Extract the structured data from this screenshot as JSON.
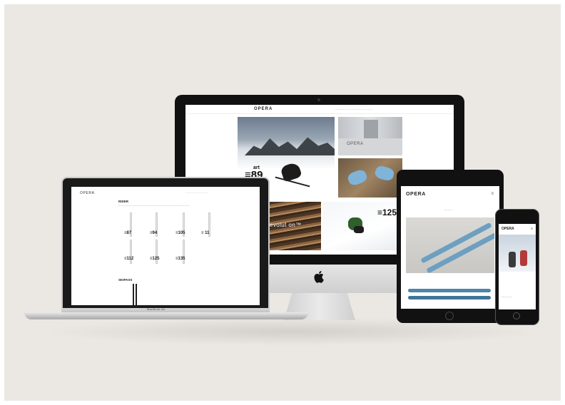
{
  "devices": {
    "imac": {
      "site_logo": "OPERA",
      "site_menu": "— — — —   — — — — —   — — —",
      "apple_logo_glyph": "",
      "tiles": {
        "mountain_brand": {
          "top": "art",
          "bottom": "≡89"
        },
        "machine_text": "OPERA",
        "wood_text": "evolut on™",
        "snow_brand": "≡125"
      }
    },
    "laptop": {
      "site_logo": "OPERA",
      "nav_menu": "— — — — — — — — — —",
      "heading": "RIDER",
      "intro_text": "— — — — — — — — — — — — — — — — — — — — — — — — — — — —",
      "ski_codes_row1": [
        "≡87",
        "≡94",
        "≡105",
        "≡ 11"
      ],
      "ski_codes_row2": [
        "≡112",
        "≡125",
        "≡135"
      ],
      "heading2": "SKIPASS",
      "base_label": "MacBook Air"
    },
    "ipad": {
      "site_logo": "OPERA",
      "menu_icon": "≡",
      "subtitle": "— — —"
    },
    "iphone": {
      "site_logo": "OPERA",
      "menu_icon": "≡",
      "caption": "— — — —"
    }
  },
  "colors": {
    "background": "#ebe7e2",
    "device_black": "#111111",
    "ski_blue": "#6d9fc0"
  }
}
